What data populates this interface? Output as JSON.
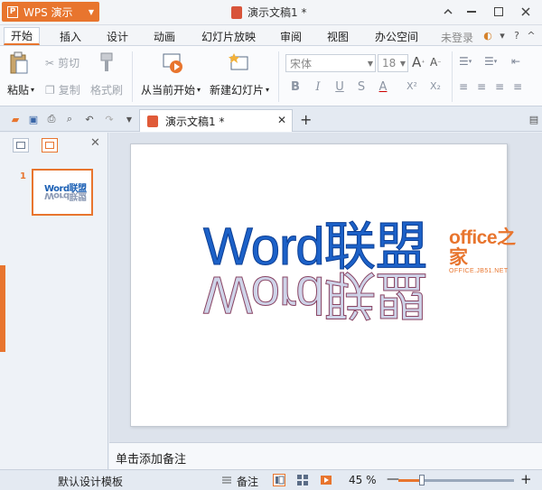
{
  "app": {
    "name": "WPS 演示",
    "doc_title": "演示文稿1 *"
  },
  "window_controls": {
    "minimize": "⌃",
    "min2": "—",
    "restore": "□",
    "close": "✕"
  },
  "menu": {
    "tabs": [
      "开始",
      "插入",
      "设计",
      "动画",
      "幻灯片放映",
      "审阅",
      "视图",
      "办公空间"
    ],
    "active": 0,
    "login": "未登录"
  },
  "ribbon": {
    "paste": "粘贴",
    "cut": "剪切",
    "copy": "复制",
    "format_painter": "格式刷",
    "from_current": "从当前开始",
    "new_slide": "新建幻灯片",
    "font_name": "宋体",
    "font_size": "18"
  },
  "doc_tab": {
    "label": "演示文稿1 *"
  },
  "left_panel": {
    "slide_number": "1",
    "thumb_text": "Word联盟"
  },
  "slide": {
    "wordart": "Word联盟"
  },
  "watermark": {
    "main": "office之家",
    "sub": "OFFICE.JB51.NET"
  },
  "notes": {
    "placeholder": "单击添加备注"
  },
  "status": {
    "template": "默认设计模板",
    "notes_btn": "备注",
    "zoom": "45 %",
    "zoom_fraction": 0.2
  },
  "colors": {
    "accent": "#e8752e",
    "wordart": "#1c61c8"
  }
}
